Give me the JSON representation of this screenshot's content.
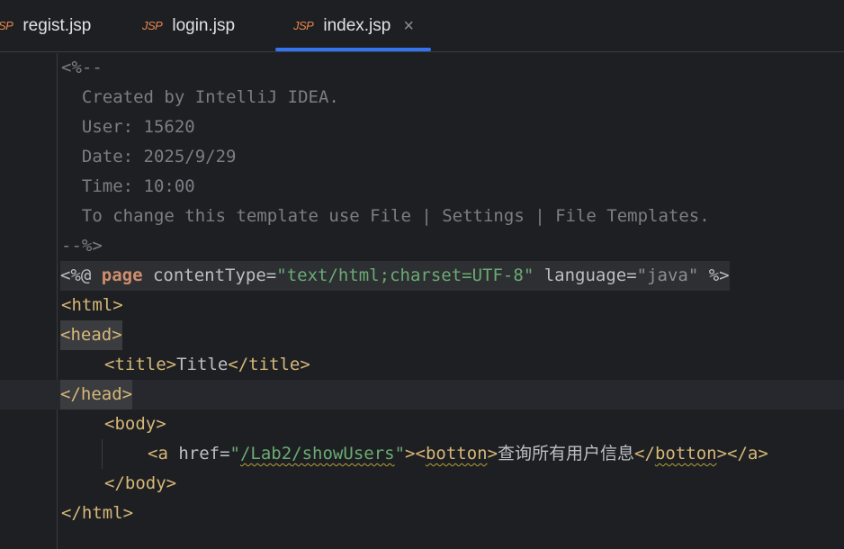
{
  "tabs": [
    {
      "icon": "JSP",
      "label": "regist.jsp",
      "active": false
    },
    {
      "icon": "JSP",
      "label": "login.jsp",
      "active": false
    },
    {
      "icon": "JSP",
      "label": "index.jsp",
      "active": true,
      "close": "×"
    }
  ],
  "code": {
    "comment_open": "<%--",
    "comment_lines": [
      "  Created by IntelliJ IDEA.",
      "  User: 15620",
      "  Date: 2025/9/29",
      "  Time: 10:00",
      "  To change this template use File | Settings | File Templates."
    ],
    "comment_close": "--%>",
    "directive": {
      "open": "<%@ ",
      "keyword": "page",
      "attr1": " contentType=",
      "value1_q": "\"",
      "value1": "text/html;charset=UTF-8",
      "attr2": " language=",
      "value2": "\"java\"",
      "close": " %>"
    },
    "html_open": "<html>",
    "head_open": "<head>",
    "title_open": "<title>",
    "title_text": "Title",
    "title_close": "</title>",
    "head_close": "</head>",
    "body_open": "<body>",
    "anchor": {
      "a_open": "<a ",
      "href_attr": "href=",
      "href_q": "\"",
      "href_value": "/Lab2/showUsers",
      "a_gt": ">",
      "btn_lt": "<",
      "btn_name": "botton",
      "btn_gt": ">",
      "text": "查询所有用户信息",
      "btn_close_lt": "</",
      "btn_close_name": "botton",
      "btn_close_gt": ">",
      "a_close": "</a>"
    },
    "body_close": "</body>",
    "html_close": "</html>"
  }
}
